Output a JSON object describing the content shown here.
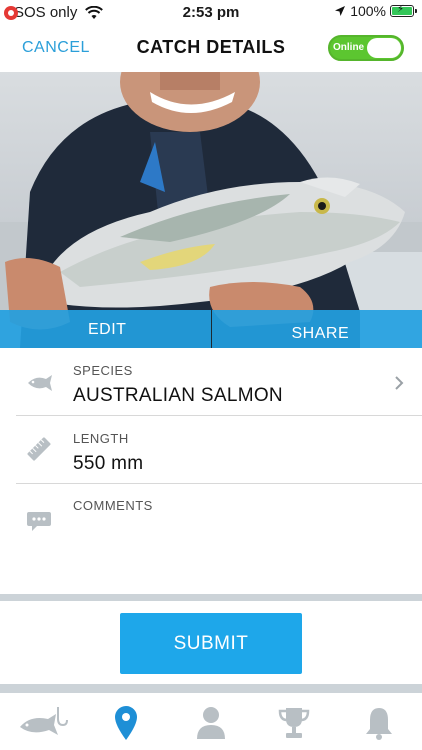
{
  "status_bar": {
    "carrier": "SOS only",
    "time": "2:53 pm",
    "battery": "100%"
  },
  "nav": {
    "cancel_label": "CANCEL",
    "title": "CATCH DETAILS",
    "toggle_label": "Online"
  },
  "photo_actions": {
    "edit_label": "EDIT",
    "share_label": "SHARE"
  },
  "details": {
    "species_label": "SPECIES",
    "species_value": "AUSTRALIAN SALMON",
    "length_label": "LENGTH",
    "length_value": "550 mm",
    "comments_label": "COMMENTS",
    "comments_value": ""
  },
  "submit_label": "SUBMIT",
  "tabs": [
    "catches-tab",
    "map-tab",
    "profile-tab",
    "trophy-tab",
    "notifications-tab"
  ],
  "colors": {
    "accent": "#1ea7ea",
    "toggle_on": "#5cc630",
    "action_bar": "#23a0e1",
    "icon_gray": "#b8bfc4"
  }
}
